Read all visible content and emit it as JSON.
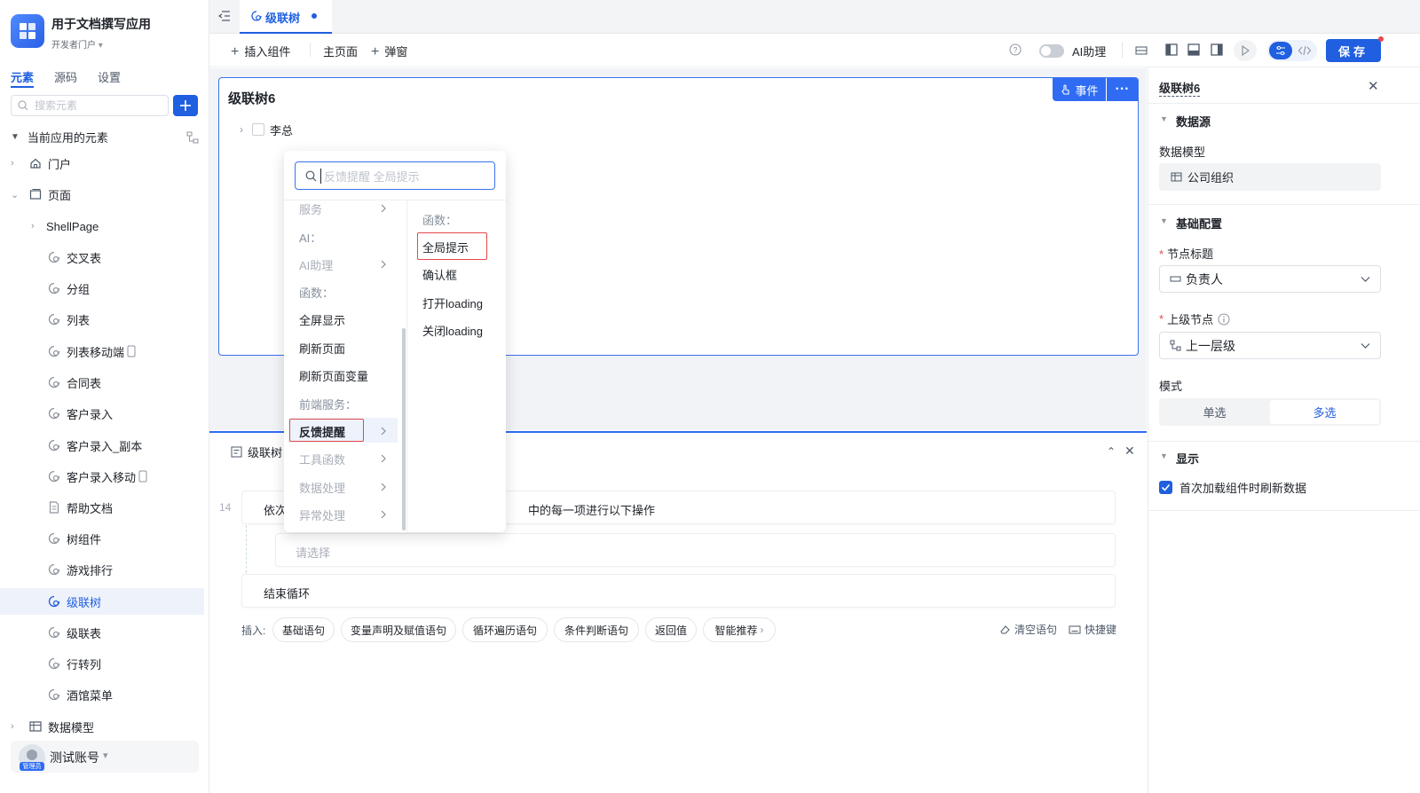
{
  "app": {
    "name": "用于文档撰写应用",
    "portal": "开发者门户"
  },
  "sidebar": {
    "tabs": [
      {
        "label": "元素",
        "active": true
      },
      {
        "label": "源码",
        "active": false
      },
      {
        "label": "设置",
        "active": false
      }
    ],
    "search_placeholder": "搜索元素",
    "section_label": "当前应用的元素",
    "tree": [
      {
        "label": "门户",
        "icon": "home-icon",
        "level": 0
      },
      {
        "label": "页面",
        "icon": "pages-icon",
        "level": 0
      },
      {
        "label": "ShellPage",
        "icon": "",
        "level": 1
      },
      {
        "label": "交叉表",
        "icon": "page-icon",
        "level": 2
      },
      {
        "label": "分组",
        "icon": "page-icon",
        "level": 2
      },
      {
        "label": "列表",
        "icon": "page-icon",
        "level": 2
      },
      {
        "label": "列表移动端",
        "icon": "page-icon",
        "level": 2,
        "mobile": true
      },
      {
        "label": "合同表",
        "icon": "page-icon",
        "level": 2
      },
      {
        "label": "客户录入",
        "icon": "page-icon",
        "level": 2
      },
      {
        "label": "客户录入_副本",
        "icon": "page-icon",
        "level": 2
      },
      {
        "label": "客户录入移动",
        "icon": "page-icon",
        "level": 2,
        "mobile": true
      },
      {
        "label": "帮助文档",
        "icon": "doc-icon",
        "level": 2
      },
      {
        "label": "树组件",
        "icon": "page-icon",
        "level": 2
      },
      {
        "label": "游戏排行",
        "icon": "page-icon",
        "level": 2
      },
      {
        "label": "级联树",
        "icon": "page-icon",
        "level": 2,
        "selected": true
      },
      {
        "label": "级联表",
        "icon": "page-icon",
        "level": 2
      },
      {
        "label": "行转列",
        "icon": "page-icon",
        "level": 2
      },
      {
        "label": "酒馆菜单",
        "icon": "page-icon",
        "level": 2
      },
      {
        "label": "数据模型",
        "icon": "table-icon",
        "level": 0
      }
    ],
    "user": {
      "name": "测试账号",
      "role": "管理员"
    }
  },
  "tabbar": {
    "active_tab": "级联树"
  },
  "toolbar": {
    "insert_component": "插入组件",
    "main_page": "主页面",
    "popup": "弹窗",
    "ai_assistant": "AI助理",
    "save": "保存"
  },
  "canvas": {
    "component_title": "级联树6",
    "event_button": "事件",
    "tree_node_label": "李总"
  },
  "logic": {
    "title": "级联树",
    "line_number": "14",
    "loop_prefix": "依次",
    "loop_suffix": "中的每一项进行以下操作",
    "select_placeholder": "请选择",
    "end_loop": "结束循环",
    "insert_label": "插入:",
    "insert_buttons": [
      "基础语句",
      "变量声明及赋值语句",
      "循环遍历语句",
      "条件判断语句",
      "返回值",
      "智能推荐"
    ],
    "clear_statements": "清空语句",
    "shortcuts": "快捷键"
  },
  "popup": {
    "search_placeholder": "反馈提醒 全局提示",
    "left_items": [
      {
        "label": "服务",
        "type": "grey",
        "chevron": true
      },
      {
        "label": "AI：",
        "type": "group"
      },
      {
        "label": "AI助理",
        "type": "grey",
        "chevron": true
      },
      {
        "label": "函数：",
        "type": "group"
      },
      {
        "label": "全屏显示",
        "type": "item"
      },
      {
        "label": "刷新页面",
        "type": "item"
      },
      {
        "label": "刷新页面变量",
        "type": "item"
      },
      {
        "label": "前端服务：",
        "type": "group"
      },
      {
        "label": "反馈提醒",
        "type": "selected",
        "chevron": true
      },
      {
        "label": "工具函数",
        "type": "grey",
        "chevron": true
      },
      {
        "label": "数据处理",
        "type": "grey",
        "chevron": true
      },
      {
        "label": "异常处理",
        "type": "grey",
        "chevron": true
      }
    ],
    "right_group": "函数：",
    "right_items": [
      {
        "label": "全局提示",
        "highlighted": true
      },
      {
        "label": "确认框"
      },
      {
        "label": "打开loading"
      },
      {
        "label": "关闭loading"
      }
    ]
  },
  "right_panel": {
    "title": "级联树6",
    "datasource_section": "数据源",
    "data_model_label": "数据模型",
    "data_model_value": "公司组织",
    "basic_section": "基础配置",
    "node_title_label": "节点标题",
    "node_title_value": "负责人",
    "parent_node_label": "上级节点",
    "parent_node_value": "上一层级",
    "mode_label": "模式",
    "mode_single": "单选",
    "mode_multi": "多选",
    "display_section": "显示",
    "refresh_on_load": "首次加载组件时刷新数据",
    "refresh_on_load_checked": true
  },
  "colors": {
    "primary": "#1f5fe0",
    "highlight_border": "#e5484d",
    "selected_bg": "#eef2fb"
  }
}
